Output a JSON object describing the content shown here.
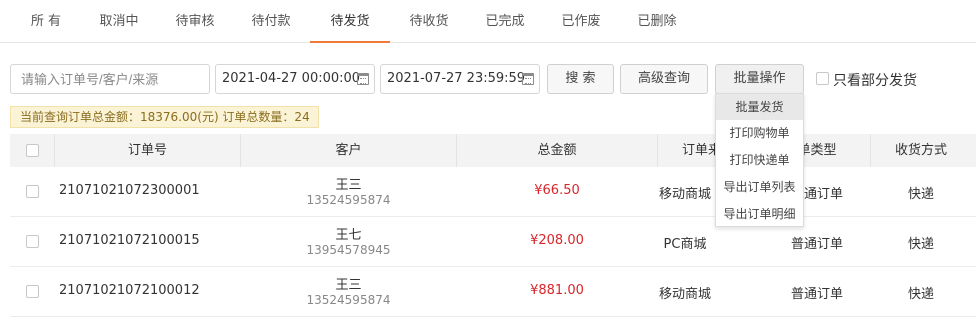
{
  "tabs": [
    {
      "label": "所 有"
    },
    {
      "label": "取消中"
    },
    {
      "label": "待审核"
    },
    {
      "label": "待付款"
    },
    {
      "label": "待发货"
    },
    {
      "label": "待收货"
    },
    {
      "label": "已完成"
    },
    {
      "label": "已作废"
    },
    {
      "label": "已删除"
    }
  ],
  "colors": {
    "accent": "#f07a3a",
    "amount": "#d9252b",
    "summary_bg": "#fbf3d6"
  },
  "search": {
    "placeholder": "请输入订单号/客户/来源",
    "start_date": "2021-04-27 00:00:00",
    "end_date": "2021-07-27 23:59:59",
    "search_label": "搜 索",
    "advanced_label": "高级查询",
    "batch_label": "批量操作",
    "only_partial_label": "只看部分发货"
  },
  "summary": {
    "text": "当前查询订单总金额：18376.00(元)   订单总数量：24"
  },
  "batch_menu": [
    "批量发货",
    "打印购物单",
    "打印快递单",
    "导出订单列表",
    "导出订单明细"
  ],
  "table": {
    "headers": [
      "订单号",
      "客户",
      "总金额",
      "订单来源",
      "单类型",
      "收货方式"
    ],
    "rows": [
      {
        "order_no": "21071021072300001",
        "customer": "王三",
        "phone": "13524595874",
        "amount": "¥66.50",
        "source": "移动商城",
        "type": "普通订单",
        "delivery": "快递"
      },
      {
        "order_no": "21071021072100015",
        "customer": "王七",
        "phone": "13954578945",
        "amount": "¥208.00",
        "source": "PC商城",
        "type": "普通订单",
        "delivery": "快递"
      },
      {
        "order_no": "21071021072100012",
        "customer": "王三",
        "phone": "13524595874",
        "amount": "¥881.00",
        "source": "移动商城",
        "type": "普通订单",
        "delivery": "快递"
      }
    ]
  }
}
